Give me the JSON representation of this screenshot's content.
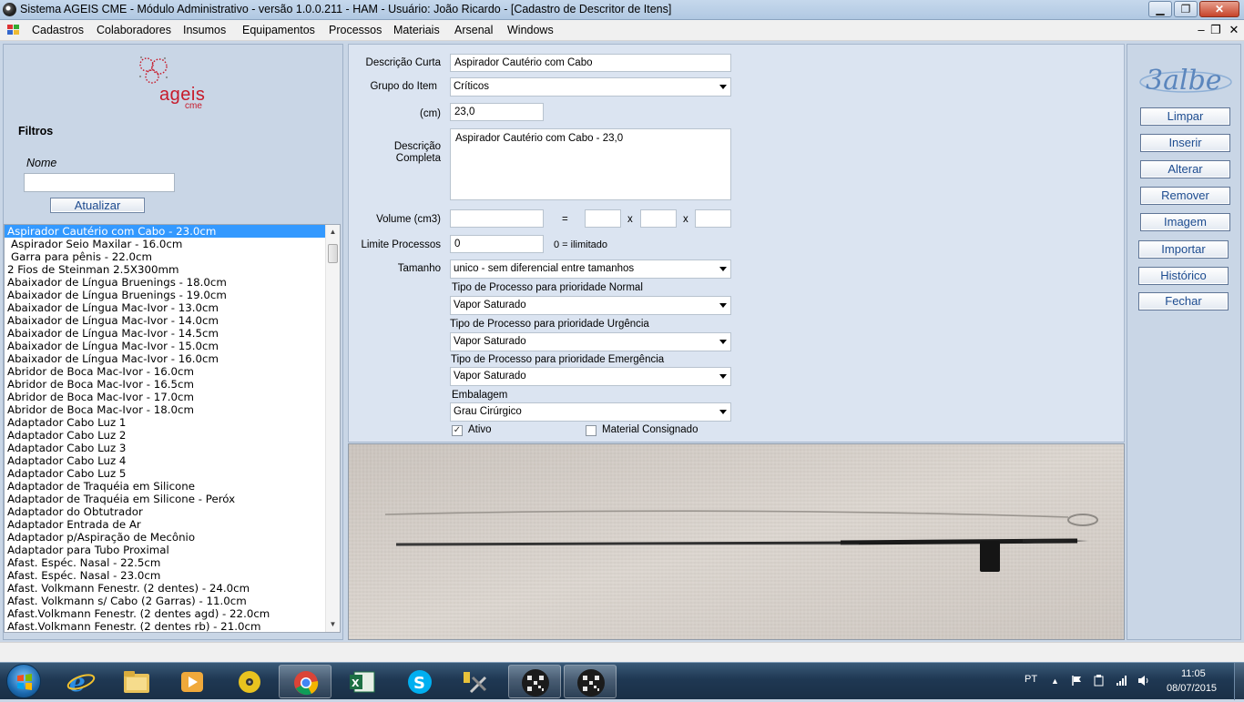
{
  "window": {
    "title": "Sistema AGEIS CME - Módulo Administrativo - versão 1.0.0.211 - HAM - Usuário: João Ricardo - [Cadastro de Descritor de Itens]",
    "minimize_glyph": "▁",
    "maximize_glyph": "❐",
    "close_glyph": "✕"
  },
  "menu": {
    "items": [
      "Cadastros",
      "Colaboradores",
      "Insumos",
      "Equipamentos",
      "Processos",
      "Materiais",
      "Arsenal",
      "Windows"
    ],
    "mdi_minimize": "–",
    "mdi_restore": "❐",
    "mdi_close": "✕"
  },
  "left": {
    "logo_text": "ageis",
    "logo_sub": "cme",
    "filters_title": "Filtros",
    "name_label": "Nome",
    "name_value": "",
    "update_button": "Atualizar",
    "scroll_up": "▲",
    "scroll_down": "▼",
    "items": [
      "Aspirador Cautério com Cabo - 23.0cm",
      "Aspirador Seio Maxilar - 16.0cm",
      "Garra para pênis - 22.0cm",
      "2 Fios de Steinman 2.5X300mm",
      "Abaixador de Língua Bruenings - 18.0cm",
      "Abaixador de Língua Bruenings - 19.0cm",
      "Abaixador de Língua Mac-Ivor - 13.0cm",
      "Abaixador de Língua Mac-Ivor - 14.0cm",
      "Abaixador de Língua Mac-Ivor - 14.5cm",
      "Abaixador de Língua Mac-Ivor - 15.0cm",
      "Abaixador de Língua Mac-Ivor - 16.0cm",
      "Abridor de Boca Mac-Ivor - 16.0cm",
      "Abridor de Boca Mac-Ivor - 16.5cm",
      "Abridor de Boca Mac-Ivor - 17.0cm",
      "Abridor de Boca Mac-Ivor - 18.0cm",
      "Adaptador Cabo Luz 1",
      "Adaptador Cabo Luz 2",
      "Adaptador Cabo Luz 3",
      "Adaptador Cabo Luz 4",
      "Adaptador Cabo Luz 5",
      "Adaptador de Traquéia em Silicone",
      "Adaptador de Traquéia em Silicone - Peróx",
      "Adaptador do Obtutrador",
      "Adaptador Entrada de Ar",
      "Adaptador p/Aspiração de Mecônio",
      "Adaptador para Tubo Proximal",
      "Afast. Espéc. Nasal - 22.5cm",
      "Afast. Espéc. Nasal - 23.0cm",
      "Afast. Volkmann Fenestr. (2 dentes) - 24.0cm",
      "Afast. Volkmann s/ Cabo (2 Garras) - 11.0cm",
      "Afast.Volkmann Fenestr. (2 dentes agd) - 22.0cm",
      "Afast.Volkmann Fenestr. (2 dentes rb) - 21.0cm"
    ]
  },
  "form": {
    "short_desc_label": "Descrição Curta",
    "short_desc_value": "Aspirador Cautério com Cabo",
    "group_label": "Grupo do Item",
    "group_value": "Críticos",
    "cm_label": "(cm)",
    "cm_value": "23,0",
    "full_desc_label_1": "Descrição",
    "full_desc_label_2": "Completa",
    "full_desc_value": "Aspirador Cautério com Cabo - 23,0",
    "volume_label": "Volume (cm3)",
    "volume_value": "",
    "equals_sign": "=",
    "times_1": "x",
    "times_2": "x",
    "dim_1": "",
    "dim_2": "",
    "dim_3": "",
    "limit_label": "Limite Processos",
    "limit_value": "0",
    "limit_hint": "0 = ilimitado",
    "size_label": "Tamanho",
    "size_value": "unico - sem diferencial entre tamanhos",
    "normal_caption": "Tipo de Processo para prioridade Normal",
    "normal_value": "Vapor Saturado",
    "urgency_caption": "Tipo de Processo para prioridade Urgência",
    "urgency_value": "Vapor Saturado",
    "emergency_caption": "Tipo de Processo para prioridade Emergência",
    "emergency_value": "Vapor Saturado",
    "packaging_caption": "Embalagem",
    "packaging_value": "Grau Cirúrgico",
    "active_label": "Ativo",
    "active_checked": true,
    "consigned_label": "Material Consignado",
    "consigned_checked": false,
    "check_glyph": "✓"
  },
  "actions": {
    "brand": "3albe",
    "buttons": [
      "Limpar",
      "Inserir",
      "Alterar",
      "Remover",
      "Imagem",
      "Importar",
      "Histórico",
      "Fechar"
    ]
  },
  "taskbar": {
    "language": "PT",
    "time": "11:05",
    "date": "08/07/2015",
    "apps": [
      "internet-explorer-icon",
      "file-explorer-icon",
      "media-player-icon",
      "disc-icon",
      "chrome-icon",
      "excel-icon",
      "skype-icon",
      "tools-icon",
      "qr-app-icon",
      "qr-app-active-icon"
    ]
  },
  "colors": {
    "selection": "#3399ff",
    "button_text": "#1d4c90",
    "panel_bg": "#c9d6e6",
    "form_bg": "#dbe4f1"
  }
}
